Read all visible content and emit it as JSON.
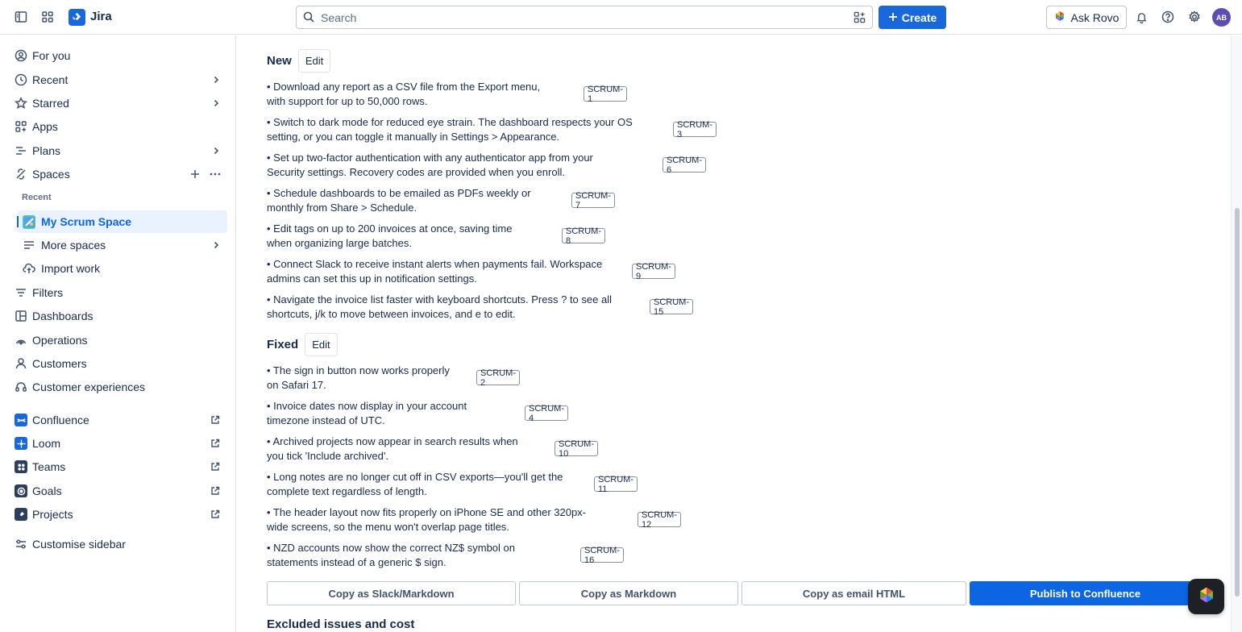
{
  "topbar": {
    "app_name": "Jira",
    "search_placeholder": "Search",
    "create_label": "Create",
    "ask_rovo_label": "Ask Rovo",
    "avatar_initials": "AB",
    "brand_color": "#1868db"
  },
  "sidebar": {
    "items": [
      {
        "label": "For you",
        "icon": "user-circle-icon"
      },
      {
        "label": "Recent",
        "icon": "clock-icon"
      },
      {
        "label": "Starred",
        "icon": "star-icon"
      },
      {
        "label": "Apps",
        "icon": "apps-icon"
      },
      {
        "label": "Plans",
        "icon": "plans-icon"
      },
      {
        "label": "Spaces",
        "icon": "spaces-icon"
      }
    ],
    "recent_label": "Recent",
    "space_item": "My Scrum Space",
    "more_spaces": "More spaces",
    "import_work": "Import work",
    "lower_items": [
      {
        "label": "Filters",
        "icon": "filter-icon"
      },
      {
        "label": "Dashboards",
        "icon": "dashboard-icon"
      },
      {
        "label": "Operations",
        "icon": "operations-icon"
      },
      {
        "label": "Customers",
        "icon": "customers-icon"
      },
      {
        "label": "Customer experiences",
        "icon": "headset-icon"
      }
    ],
    "apps": [
      {
        "label": "Confluence",
        "icon": "confluence-icon",
        "color": "#1868db"
      },
      {
        "label": "Loom",
        "icon": "loom-icon",
        "color": "#1868db"
      },
      {
        "label": "Teams",
        "icon": "teams-icon",
        "color": "#2c3e5d"
      },
      {
        "label": "Goals",
        "icon": "goals-icon",
        "color": "#2c3e5d"
      },
      {
        "label": "Projects",
        "icon": "projects-icon",
        "color": "#2c3e5d"
      }
    ],
    "customise": "Customise sidebar"
  },
  "main": {
    "new_section": {
      "title": "New",
      "edit_label": "Edit",
      "entries": [
        {
          "line1": "• Download any report as a CSV file from the Export menu,",
          "line2": "with support for up to 50,000 rows.",
          "key": "SCRUM-1"
        },
        {
          "line1": "• Switch to dark mode for reduced eye strain. The dashboard respects your OS",
          "line2": "setting, or you can toggle it manually in Settings > Appearance.",
          "key": "SCRUM-3"
        },
        {
          "line1": "• Set up two-factor authentication with any authenticator app from your",
          "line2": "Security settings. Recovery codes are provided when you enroll.",
          "key": "SCRUM-6"
        },
        {
          "line1": "• Schedule dashboards to be emailed as PDFs weekly or",
          "line2": "monthly from Share > Schedule.",
          "key": "SCRUM-7"
        },
        {
          "line1": "• Edit tags on up to 200 invoices at once, saving time",
          "line2": "when organizing large batches.",
          "key": "SCRUM-8"
        },
        {
          "line1": "• Connect Slack to receive instant alerts when payments fail. Workspace",
          "line2": "admins can set this up in notification settings.",
          "key": "SCRUM-9"
        },
        {
          "line1": "• Navigate the invoice list faster with keyboard shortcuts. Press ? to see all",
          "line2": "shortcuts, j/k to move between invoices, and e to edit.",
          "key": "SCRUM-15"
        }
      ]
    },
    "fixed_section": {
      "title": "Fixed",
      "edit_label": "Edit",
      "entries": [
        {
          "line1": "• The sign in button now works properly",
          "line2": "on Safari 17.",
          "key": "SCRUM-2"
        },
        {
          "line1": "• Invoice dates now display in your account",
          "line2": "timezone instead of UTC.",
          "key": "SCRUM-4"
        },
        {
          "line1": "• Archived projects now appear in search results when",
          "line2": "you tick 'Include archived'.",
          "key": "SCRUM-10"
        },
        {
          "line1": "• Long notes are no longer cut off in CSV exports—you'll get the",
          "line2": "complete text regardless of length.",
          "key": "SCRUM-11"
        },
        {
          "line1": "• The header layout now fits properly on iPhone SE and other 320px-",
          "line2": "wide screens, so the menu won't overlap page titles.",
          "key": "SCRUM-12"
        },
        {
          "line1": "• NZD accounts now show the correct NZ$ symbol on",
          "line2": "statements instead of a generic $ sign.",
          "key": "SCRUM-16"
        }
      ]
    },
    "actions": {
      "copy_slack": "Copy as Slack/Markdown",
      "copy_markdown": "Copy as Markdown",
      "copy_email": "Copy as email HTML",
      "publish": "Publish to Confluence"
    },
    "excluded_heading": "Excluded issues and cost"
  }
}
